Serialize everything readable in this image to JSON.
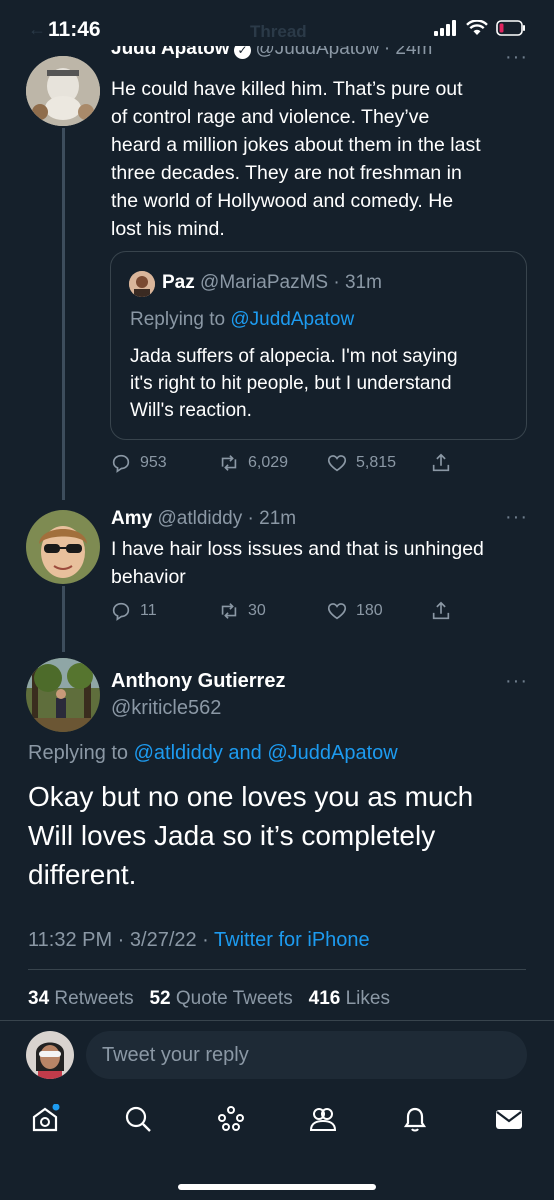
{
  "status_bar": {
    "time": "11:46",
    "ghost_title": "Thread"
  },
  "tweet1": {
    "name": "Judd Apatow",
    "handle": "@JuddApatow",
    "time": "· 24m",
    "body_lines": [
      "He could have killed him.  That’s pure out",
      "of control rage and violence.    They’ve",
      "heard a million jokes about them in the last",
      "three decades.  They are not freshman in",
      "the world of Hollywood and comedy.  He",
      "lost his mind."
    ],
    "quote": {
      "name": "Paz",
      "handle": "@MariaPazMS · 31m",
      "replying_prefix": "Replying to",
      "replying_to": "@JuddApatow",
      "body_lines": [
        "Jada suffers of alopecia. I'm not saying",
        "it's right to hit people,  but I understand",
        "Will's reaction."
      ]
    },
    "replies": "953",
    "retweets": "6,029",
    "likes": "5,815"
  },
  "tweet2": {
    "name": "Amy",
    "handle": "@atldiddy · 21m",
    "body_lines": [
      "I have hair loss issues and that is unhinged",
      "behavior"
    ],
    "replies": "11",
    "retweets": "30",
    "likes": "180"
  },
  "main_tweet": {
    "name": "Anthony  Gutierrez",
    "handle": "@kriticle562",
    "replying_prefix": "Replying to",
    "replying_to": "@atldiddy and @JuddApatow",
    "body_lines": [
      "Okay but no one loves you as much",
      "Will loves Jada so it’s completely",
      "different."
    ],
    "timestamp": "11:32 PM · 3/27/22 ·",
    "source": "Twitter for iPhone",
    "stats": {
      "retweets_count": "34",
      "retweets_label": "Retweets",
      "quotes_count": "52",
      "quotes_label": "Quote Tweets",
      "likes_count": "416",
      "likes_label": "Likes"
    }
  },
  "reply_box": {
    "placeholder": "Tweet your reply"
  },
  "colors": {
    "background": "#15202b",
    "accent": "#1d9bf0",
    "muted": "#8b98a5",
    "border": "#38444d"
  },
  "nav_icons": [
    "home-icon",
    "search-icon",
    "spaces-icon",
    "communities-icon",
    "notifications-icon",
    "messages-icon"
  ]
}
